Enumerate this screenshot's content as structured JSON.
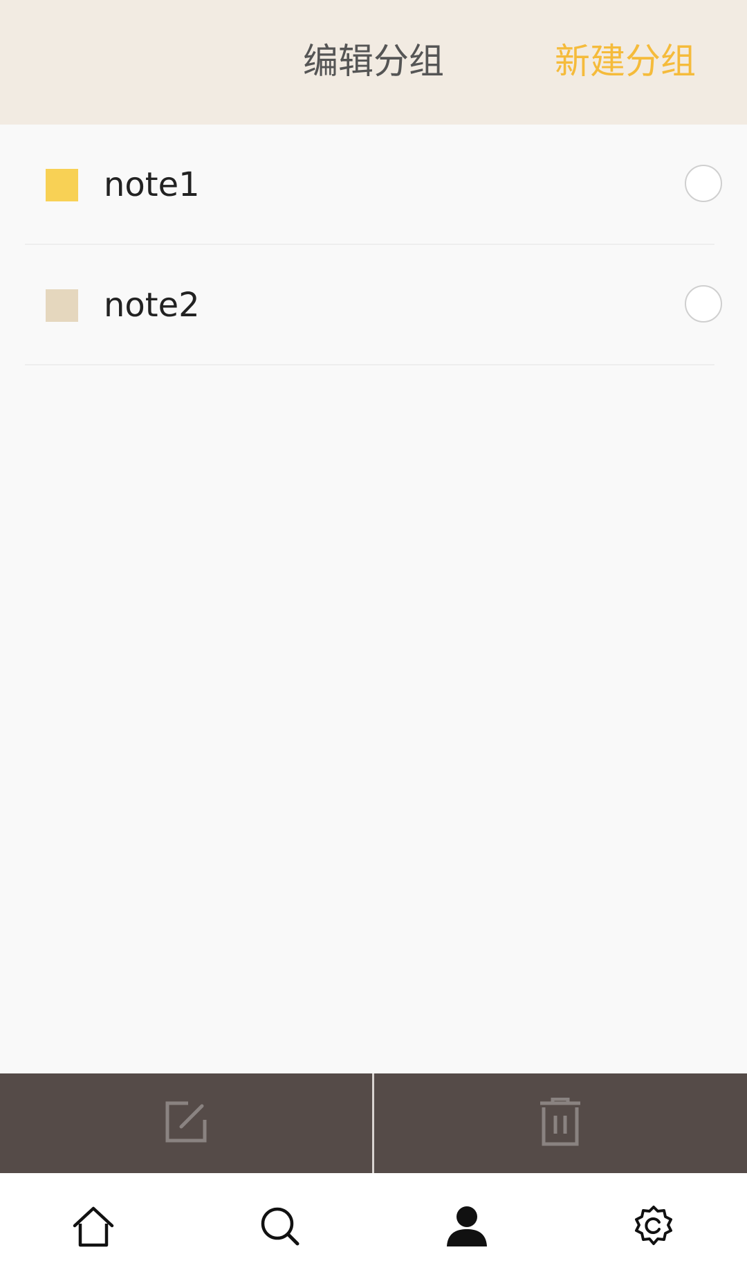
{
  "header": {
    "title": "编辑分组",
    "new_group_label": "新建分组",
    "accent_color": "#f5bb3b",
    "background_color": "#f2ebe2"
  },
  "groups": [
    {
      "label": "note1",
      "color": "#f8d155",
      "selected": false
    },
    {
      "label": "note2",
      "color": "#e5d7be",
      "selected": false
    }
  ],
  "action_bar": {
    "background_color": "#554b48",
    "actions": [
      {
        "icon": "edit-icon"
      },
      {
        "icon": "trash-icon"
      }
    ]
  },
  "bottom_nav": {
    "items": [
      {
        "icon": "home-icon",
        "active": false
      },
      {
        "icon": "search-icon",
        "active": false
      },
      {
        "icon": "profile-icon",
        "active": true
      },
      {
        "icon": "settings-icon",
        "active": false
      }
    ]
  }
}
